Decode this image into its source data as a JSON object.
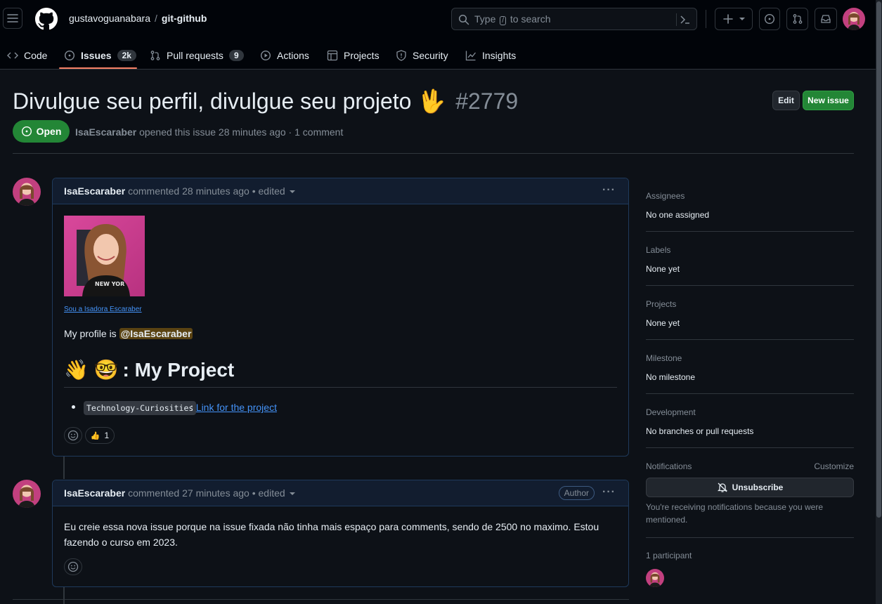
{
  "header": {
    "owner": "gustavoguanabara",
    "separator": "/",
    "repo": "git-github",
    "search_placeholder_pre": "Type",
    "search_key": "/",
    "search_placeholder_post": "to search"
  },
  "tabs": [
    {
      "label": "Code",
      "icon": "code-icon"
    },
    {
      "label": "Issues",
      "count": "2k",
      "icon": "issue-opened-icon",
      "selected": true
    },
    {
      "label": "Pull requests",
      "count": "9",
      "icon": "pull-request-icon"
    },
    {
      "label": "Actions",
      "icon": "play-icon"
    },
    {
      "label": "Projects",
      "icon": "table-icon"
    },
    {
      "label": "Security",
      "icon": "shield-icon"
    },
    {
      "label": "Insights",
      "icon": "graph-icon"
    }
  ],
  "issue": {
    "title": "Divulgue seu perfil, divulgue seu projeto 🖖",
    "number": "#2779",
    "state": "Open",
    "author": "IsaEscaraber",
    "opened_text": "opened this issue 28 minutes ago · 1 comment",
    "edit_label": "Edit",
    "new_issue_label": "New issue"
  },
  "comments": [
    {
      "author": "IsaEscaraber",
      "meta": "commented 28 minutes ago • edited",
      "image_caption": "Sou a Isadora Escaraber",
      "profile_prefix": "My profile is",
      "mention": "@IsaEscaraber",
      "heading": ": My Project",
      "heading_emojis": "👋 🤓",
      "list_code": "Technology-Curiosities",
      "list_sep": ":",
      "list_link": "Link for the project",
      "reaction_emoji": "👍",
      "reaction_count": "1"
    },
    {
      "author": "IsaEscaraber",
      "meta": "commented 27 minutes ago • edited",
      "badge": "Author",
      "body": "Eu creie essa nova issue porque na issue fixada não tinha mais espaço para comments, sendo de 2500 no maximo. Estou fazendo o curso em 2023."
    }
  ],
  "sidebar": {
    "assignees_label": "Assignees",
    "assignees_value": "No one assigned",
    "labels_label": "Labels",
    "labels_value": "None yet",
    "projects_label": "Projects",
    "projects_value": "None yet",
    "milestone_label": "Milestone",
    "milestone_value": "No milestone",
    "development_label": "Development",
    "development_value": "No branches or pull requests",
    "notifications_label": "Notifications",
    "customize_label": "Customize",
    "unsubscribe_label": "Unsubscribe",
    "notification_note": "You're receiving notifications because you were mentioned.",
    "participants_label": "1 participant"
  },
  "colors": {
    "background": "#0d1117",
    "open_green": "#238636",
    "link_blue": "#4493f8",
    "tab_underline": "#f78166"
  }
}
